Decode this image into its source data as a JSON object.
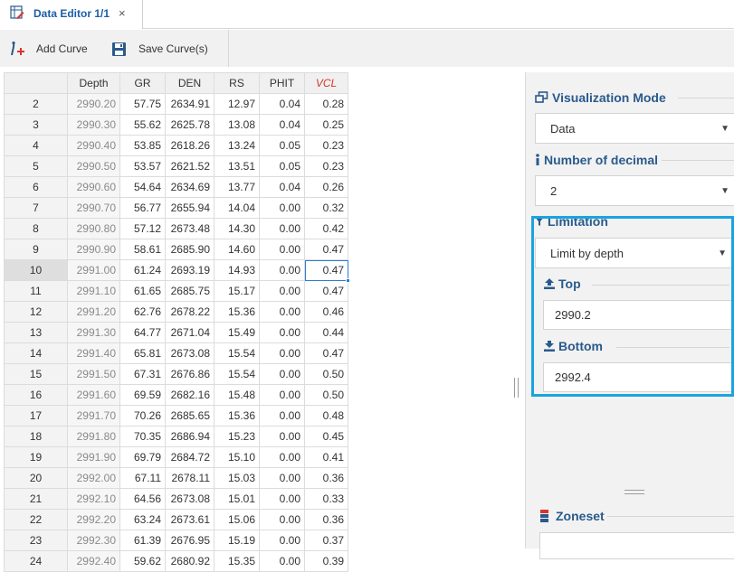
{
  "tab": {
    "title": "Data Editor 1/1",
    "close_glyph": "×",
    "icon": "data-editor-icon"
  },
  "toolbar": {
    "add_curve": "Add Curve",
    "save_curves": "Save Curve(s)"
  },
  "grid": {
    "columns": [
      "Depth",
      "GR",
      "DEN",
      "RS",
      "PHIT",
      "VCL"
    ],
    "rows": [
      [
        "2",
        "2990.20",
        "57.75",
        "2634.91",
        "12.97",
        "0.04",
        "0.28"
      ],
      [
        "3",
        "2990.30",
        "55.62",
        "2625.78",
        "13.08",
        "0.04",
        "0.25"
      ],
      [
        "4",
        "2990.40",
        "53.85",
        "2618.26",
        "13.24",
        "0.05",
        "0.23"
      ],
      [
        "5",
        "2990.50",
        "53.57",
        "2621.52",
        "13.51",
        "0.05",
        "0.23"
      ],
      [
        "6",
        "2990.60",
        "54.64",
        "2634.69",
        "13.77",
        "0.04",
        "0.26"
      ],
      [
        "7",
        "2990.70",
        "56.77",
        "2655.94",
        "14.04",
        "0.00",
        "0.32"
      ],
      [
        "8",
        "2990.80",
        "57.12",
        "2673.48",
        "14.30",
        "0.00",
        "0.42"
      ],
      [
        "9",
        "2990.90",
        "58.61",
        "2685.90",
        "14.60",
        "0.00",
        "0.47"
      ],
      [
        "10",
        "2991.00",
        "61.24",
        "2693.19",
        "14.93",
        "0.00",
        "0.47"
      ],
      [
        "11",
        "2991.10",
        "61.65",
        "2685.75",
        "15.17",
        "0.00",
        "0.47"
      ],
      [
        "12",
        "2991.20",
        "62.76",
        "2678.22",
        "15.36",
        "0.00",
        "0.46"
      ],
      [
        "13",
        "2991.30",
        "64.77",
        "2671.04",
        "15.49",
        "0.00",
        "0.44"
      ],
      [
        "14",
        "2991.40",
        "65.81",
        "2673.08",
        "15.54",
        "0.00",
        "0.47"
      ],
      [
        "15",
        "2991.50",
        "67.31",
        "2676.86",
        "15.54",
        "0.00",
        "0.50"
      ],
      [
        "16",
        "2991.60",
        "69.59",
        "2682.16",
        "15.48",
        "0.00",
        "0.50"
      ],
      [
        "17",
        "2991.70",
        "70.26",
        "2685.65",
        "15.36",
        "0.00",
        "0.48"
      ],
      [
        "18",
        "2991.80",
        "70.35",
        "2686.94",
        "15.23",
        "0.00",
        "0.45"
      ],
      [
        "19",
        "2991.90",
        "69.79",
        "2684.72",
        "15.10",
        "0.00",
        "0.41"
      ],
      [
        "20",
        "2992.00",
        "67.11",
        "2678.11",
        "15.03",
        "0.00",
        "0.36"
      ],
      [
        "21",
        "2992.10",
        "64.56",
        "2673.08",
        "15.01",
        "0.00",
        "0.33"
      ],
      [
        "22",
        "2992.20",
        "63.24",
        "2673.61",
        "15.06",
        "0.00",
        "0.36"
      ],
      [
        "23",
        "2992.30",
        "61.39",
        "2676.95",
        "15.19",
        "0.00",
        "0.37"
      ],
      [
        "24",
        "2992.40",
        "59.62",
        "2680.92",
        "15.35",
        "0.00",
        "0.39"
      ]
    ],
    "selected_row": "10",
    "active_column": "VCL"
  },
  "panel": {
    "visualization": {
      "label": "Visualization Mode",
      "value": "Data",
      "icon": "windows-icon"
    },
    "decimal": {
      "label": "Number of decimal",
      "value": "2",
      "icon": "info-icon"
    },
    "limitation": {
      "label": "Limitation",
      "value": "Limit by depth",
      "icon": "filter-icon"
    },
    "top": {
      "label": "Top",
      "value": "2990.2",
      "icon": "upload-icon"
    },
    "bottom": {
      "label": "Bottom",
      "value": "2992.4",
      "icon": "download-icon"
    },
    "zoneset": {
      "label": "Zoneset",
      "value": "",
      "icon": "zoneset-icon"
    }
  },
  "colors": {
    "accent": "#1a5fa8",
    "highlight": "#1aa3e0",
    "vcl_header": "#d9352b",
    "section": "#2a5a8c"
  }
}
